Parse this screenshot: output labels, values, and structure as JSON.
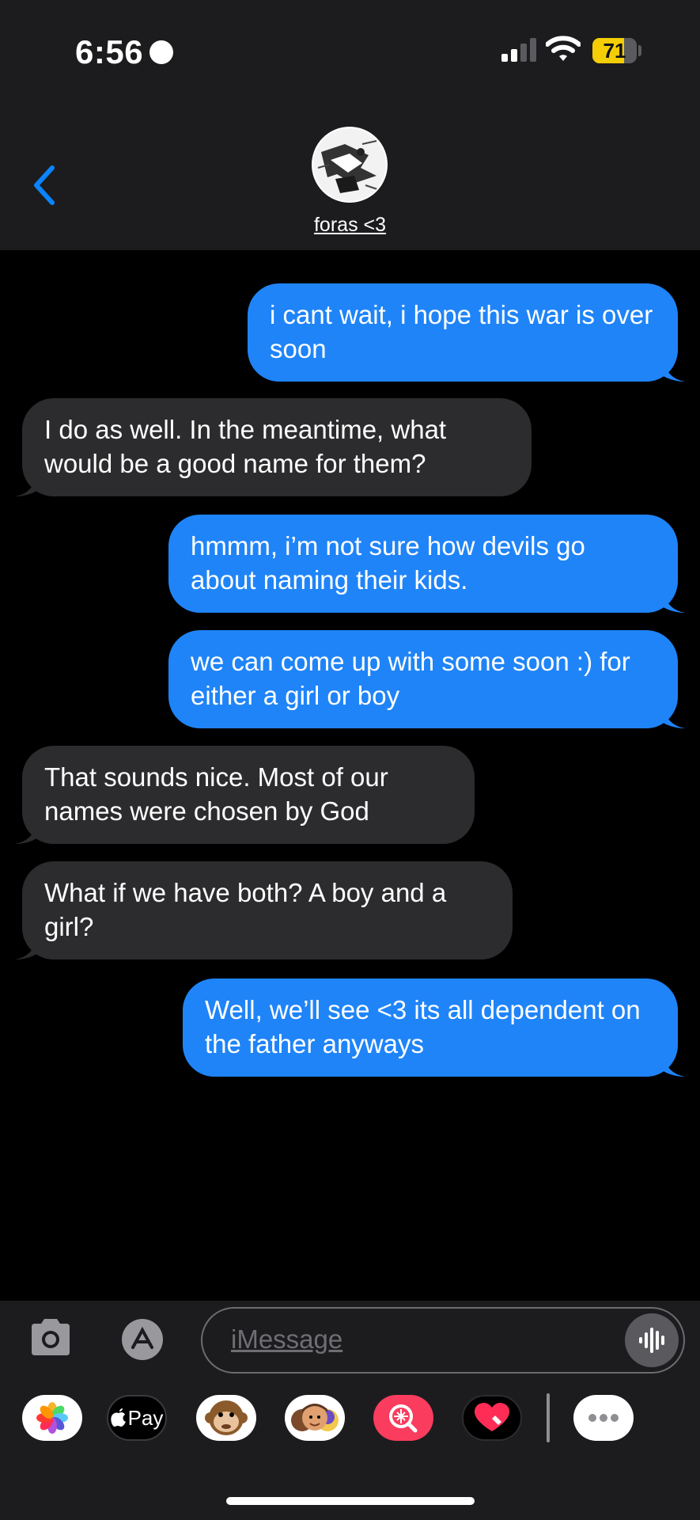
{
  "status_bar": {
    "time": "6:56",
    "battery": "71",
    "battery_level_percent": 71
  },
  "header": {
    "contact_name": "foras <3"
  },
  "messages": [
    {
      "from": "me",
      "text": "i cant wait, i hope this war is over soon"
    },
    {
      "from": "them",
      "text": "I do as well. In the meantime, what would be a good name for them?"
    },
    {
      "from": "me",
      "text": "hmmm, i’m not sure how devils go about naming their kids."
    },
    {
      "from": "me",
      "text": "we can come up with some soon :) for either a girl or boy"
    },
    {
      "from": "them",
      "text": "That sounds nice. Most of our names were chosen by God"
    },
    {
      "from": "them",
      "text": "What if we have both? A boy and a girl?"
    },
    {
      "from": "me",
      "text": "Well, we’ll see <3 its all dependent on the father anyways"
    }
  ],
  "composer": {
    "placeholder": "iMessage"
  },
  "apps": [
    {
      "name": "photos-app-icon"
    },
    {
      "name": "apple-pay-icon",
      "label": "Pay"
    },
    {
      "name": "memoji-monkey-icon"
    },
    {
      "name": "memoji-stickers-icon"
    },
    {
      "name": "image-search-icon"
    },
    {
      "name": "digital-touch-heart-icon"
    },
    {
      "name": "more-apps-icon"
    }
  ],
  "colors": {
    "sent_bubble": "#1f84f8",
    "received_bubble": "#2c2c2e",
    "accent": "#0a84ff",
    "battery": "#f4cd05"
  }
}
